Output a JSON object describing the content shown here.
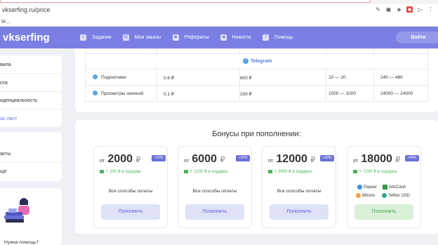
{
  "browser": {
    "url": "vkserfing.ru/price",
    "bookmark": "le..."
  },
  "header": {
    "logo": "vkserfing",
    "nav": [
      {
        "label": "Задания",
        "icon": "tasks-icon"
      },
      {
        "label": "Мои заказы",
        "icon": "orders-icon"
      },
      {
        "label": "Рефералы",
        "icon": "referrals-icon"
      },
      {
        "label": "Новости",
        "icon": "megaphone-icon"
      },
      {
        "label": "Помощь",
        "icon": "help-icon"
      }
    ],
    "login": "Войти"
  },
  "sidebar": {
    "items": [
      "вила",
      "ота",
      "иденциальность",
      "ас-лист"
    ],
    "items2": [
      "акты",
      "ще"
    ],
    "help": "Нужна помощь?"
  },
  "table": {
    "section": "Telegram",
    "rows": [
      {
        "name": "Подписчики",
        "price": "0.6 ₽",
        "sum": "600 ₽",
        "range": "10 — 20",
        "speed": "240 — 480"
      },
      {
        "name": "Просмотры записей",
        "price": "0.1 ₽",
        "sum": "100 ₽",
        "range": "1000 — 1000",
        "speed": "24000 — 24000"
      }
    ]
  },
  "bonuses": {
    "title": "Бонусы при пополнении:",
    "prefix": "от",
    "currency": "₽",
    "tiers": [
      {
        "amount": "2000",
        "pct": "+10%",
        "gift": "+ 200 ₽ в подарок",
        "methods": "Все способы оплаты",
        "button": "Пополнить"
      },
      {
        "amount": "6000",
        "pct": "+20%",
        "gift": "+ 1200 ₽ в подарок",
        "methods": "Все способы оплаты",
        "button": "Пополнить"
      },
      {
        "amount": "12000",
        "pct": "+30%",
        "gift": "+ 3600 ₽ в подарок",
        "methods": "Все способы оплаты",
        "button": "Пополнить"
      },
      {
        "amount": "18000",
        "pct": "+40%",
        "gift": "+ 7200 ₽ в подарок",
        "methods": [
          "Payeer",
          "AdvCash",
          "Bitcoin",
          "Tether USD"
        ],
        "button": "Пополнить"
      }
    ]
  },
  "colors": {
    "accent": "#7b7fe4",
    "green": "#49b35a",
    "telegram": "#5aa7df"
  }
}
